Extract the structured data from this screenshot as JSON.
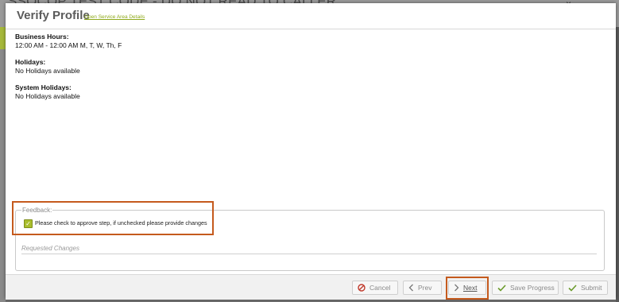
{
  "background": {
    "title": "SSOCOP TEST CODE - DO NOT READ TO CALLER",
    "close_glyph": "×"
  },
  "dialog": {
    "title": "Verify Profile",
    "service_area_link": "Open Service Area Details"
  },
  "profile": {
    "business_hours_label": "Business Hours:",
    "business_hours_value": "12:00 AM - 12:00 AM M, T, W, Th, F",
    "holidays_label": "Holidays:",
    "holidays_value": "No Holidays available",
    "system_holidays_label": "System Holidays:",
    "system_holidays_value": "No Holidays available"
  },
  "feedback": {
    "legend": "Feedback:",
    "approve_checked": true,
    "approve_label": "Please check to approve step, if unchecked please provide changes",
    "requested_changes_placeholder": "Requested Changes",
    "requested_changes_value": ""
  },
  "footer": {
    "cancel_label": "Cancel",
    "prev_label": "Prev",
    "next_label": "Next",
    "save_label": "Save Progress",
    "submit_label": "Submit"
  },
  "colors": {
    "accent_green": "#a9bd2c",
    "highlight_orange": "#c55a1d",
    "cancel_red": "#c0392b",
    "check_green": "#6a9a2a"
  }
}
